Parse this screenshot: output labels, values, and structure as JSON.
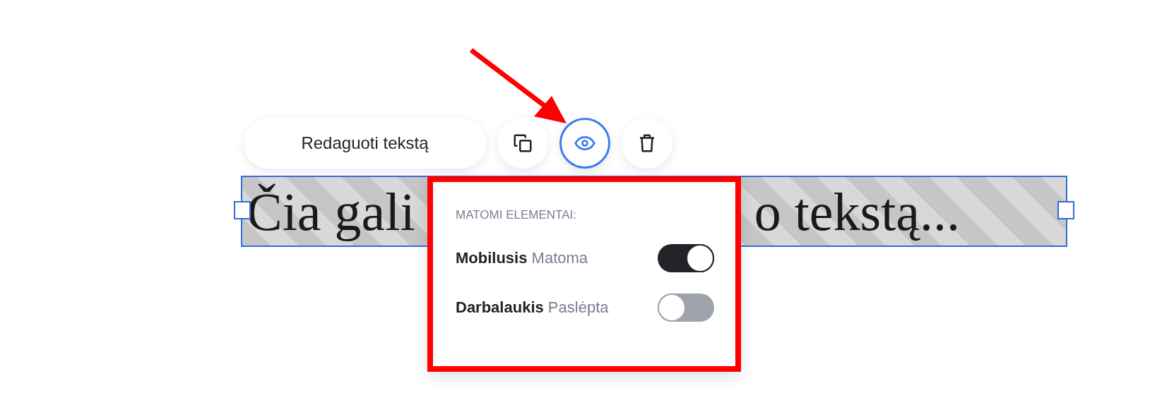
{
  "toolbar": {
    "edit_button": {
      "label": "Redaguoti tekstą"
    },
    "icon_buttons": [
      {
        "selected": false
      },
      {
        "selected": true
      },
      {
        "selected": false
      }
    ]
  },
  "text_block": {
    "text_start": "Čia gali",
    "text_end": "o tekstą..."
  },
  "visibility_popup": {
    "heading": "MATOMI ELEMENTAI:",
    "rows": [
      {
        "label": "Mobilusis",
        "status": "Matoma",
        "on": true
      },
      {
        "label": "Darbalaukis",
        "status": "Paslėpta",
        "on": false
      }
    ]
  }
}
